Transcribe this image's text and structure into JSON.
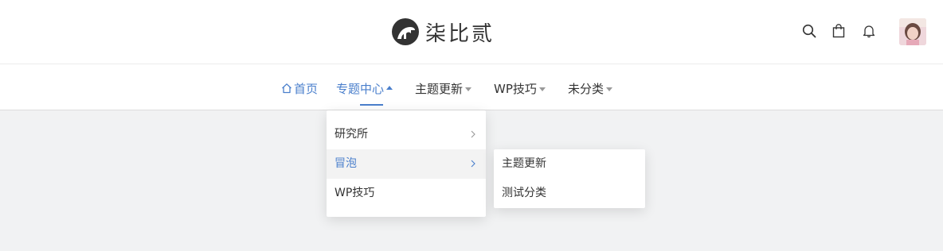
{
  "brand": {
    "name": "柒比贰"
  },
  "header": {
    "icons": [
      "search-icon",
      "bag-icon",
      "bell-icon"
    ]
  },
  "nav": {
    "items": [
      {
        "label": "首页",
        "active": true,
        "icon": "home-icon"
      },
      {
        "label": "专题中心",
        "active": true,
        "expanded": true
      },
      {
        "label": "主题更新"
      },
      {
        "label": "WP技巧"
      },
      {
        "label": "未分类"
      }
    ]
  },
  "dropdown": {
    "items": [
      {
        "label": "研究所",
        "has_submenu": true
      },
      {
        "label": "冒泡",
        "has_submenu": true,
        "hovered": true
      },
      {
        "label": "WP技巧"
      }
    ]
  },
  "submenu": {
    "items": [
      {
        "label": "主题更新"
      },
      {
        "label": "测试分类"
      }
    ]
  },
  "colors": {
    "accent": "#4a7fcc",
    "background": "#f1f2f3"
  }
}
